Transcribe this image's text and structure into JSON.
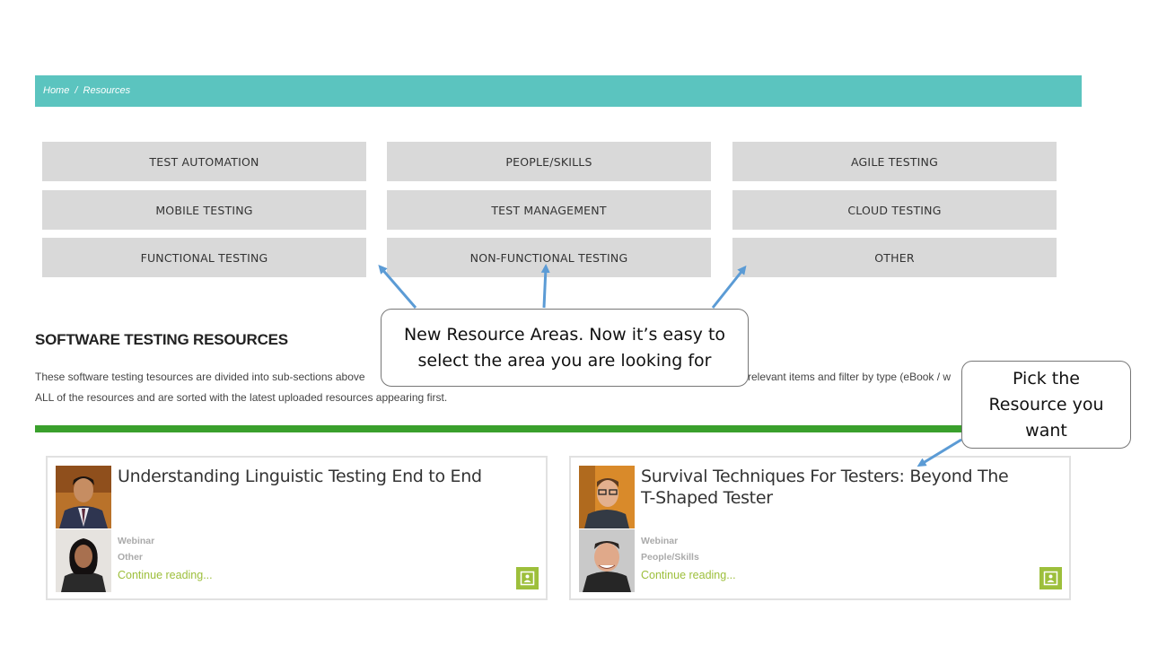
{
  "breadcrumb": {
    "home": "Home",
    "separator": "/",
    "current": "Resources"
  },
  "categories": [
    "TEST AUTOMATION",
    "PEOPLE/SKILLS",
    "AGILE TESTING",
    "MOBILE TESTING",
    "TEST MANAGEMENT",
    "CLOUD TESTING",
    "FUNCTIONAL TESTING",
    "NON-FUNCTIONAL TESTING",
    "OTHER"
  ],
  "section": {
    "title": "SOFTWARE TESTING RESOURCES",
    "line1_left": "These software testing tesources are divided into sub-sections above",
    "line1_right": "relevant items and filter by type (eBook / w",
    "line2": "ALL of the resources and are sorted with the latest uploaded resources appearing first."
  },
  "cards": [
    {
      "title": "Understanding Linguistic Testing End to End",
      "type": "Webinar",
      "category": "Other",
      "link": "Continue reading..."
    },
    {
      "title": "Survival Techniques For Testers: Beyond The T-Shaped Tester",
      "type": "Webinar",
      "category": "People/Skills",
      "link": "Continue reading..."
    }
  ],
  "callouts": {
    "areas": {
      "line1": "New Resource Areas. Now it’s easy to",
      "line2": "select the area you are looking for"
    },
    "pick": {
      "line1": "Pick the",
      "line2": "Resource you",
      "line3": "want"
    }
  },
  "colors": {
    "breadcrumb_bg": "#5bc4bf",
    "category_bg": "#d9d9d9",
    "green_rule": "#3aa02c",
    "link_green": "#9dbf3b",
    "arrow_blue": "#5b9bd5"
  }
}
